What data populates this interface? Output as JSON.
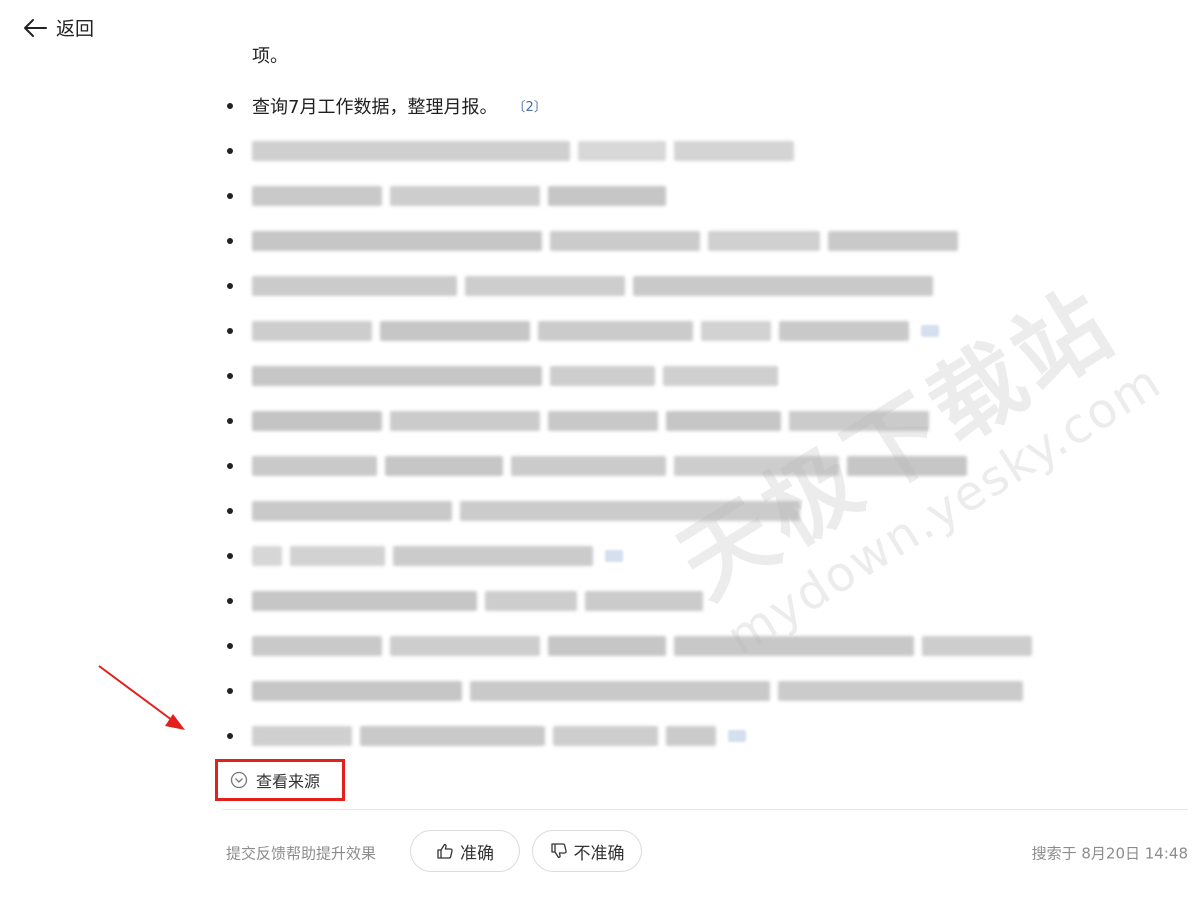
{
  "header": {
    "back_label": "返回"
  },
  "answer": {
    "partial_line": "项。",
    "first_item": {
      "text": "查询7月工作数据，整理月报。",
      "citation": "〔2〕"
    }
  },
  "sources": {
    "label": "查看来源"
  },
  "feedback": {
    "prompt": "提交反馈帮助提升效果",
    "accurate": "准确",
    "inaccurate": "不准确",
    "timestamp": "搜索于 8月20日 14:48"
  },
  "watermark": {
    "brand": "天极下载站",
    "domain": "mydown.yesky.com"
  }
}
